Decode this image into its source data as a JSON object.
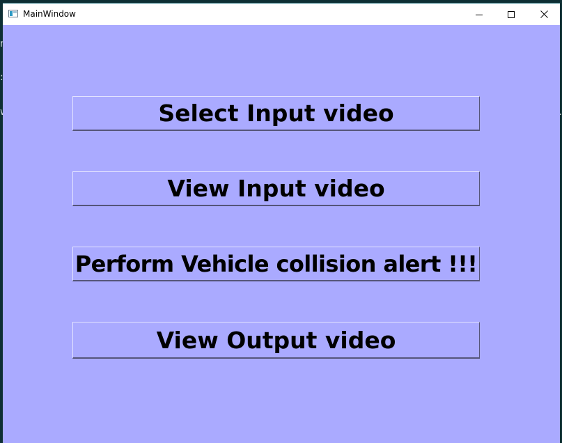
{
  "window": {
    "title": "MainWindow",
    "background_color": "#aaaaff",
    "controls": {
      "minimize_icon": "minimize-icon",
      "maximize_icon": "maximize-icon",
      "close_icon": "close-icon"
    }
  },
  "buttons": {
    "select_input": "Select Input video",
    "view_input": "View Input video",
    "perform_alert": "Perform Vehicle collision alert !!!",
    "view_output": "View Output video"
  }
}
